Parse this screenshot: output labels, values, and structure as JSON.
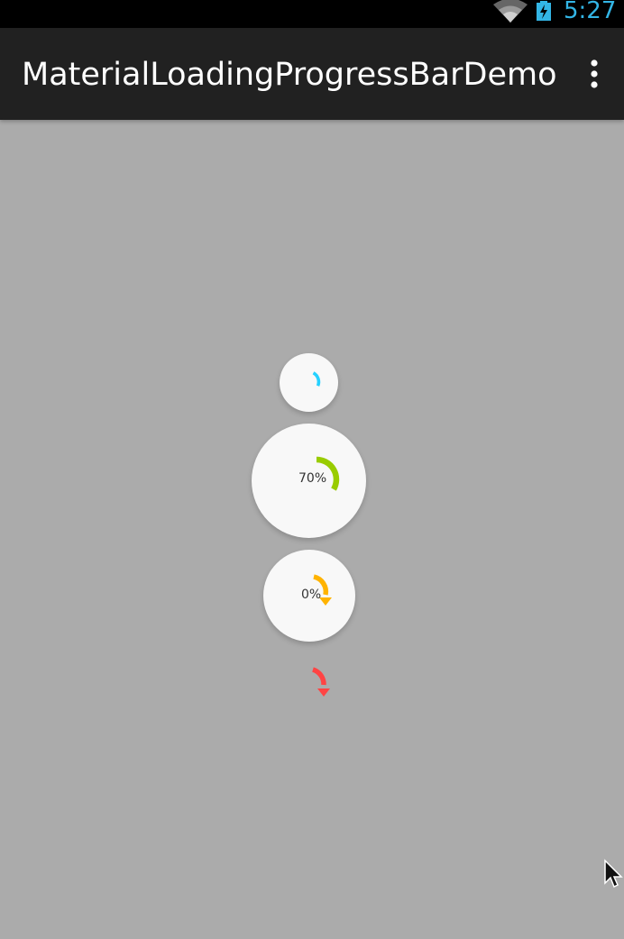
{
  "status_bar": {
    "time": "5:27",
    "icons": [
      "wifi-icon",
      "battery-charging-icon"
    ],
    "time_color": "#33b5e5"
  },
  "action_bar": {
    "title": "MaterialLoadingProgressBarDemo",
    "overflow_icon": "overflow-menu-icon"
  },
  "loaders": [
    {
      "name": "loader-small",
      "progress_label": "",
      "arc_color": "#25d1ff",
      "has_background": true,
      "arrow": false
    },
    {
      "name": "loader-large",
      "progress_label": "70%",
      "arc_color": "#99cc00",
      "has_background": true,
      "arrow": false
    },
    {
      "name": "loader-medium",
      "progress_label": "0%",
      "arc_color": "#ffb300",
      "has_background": true,
      "arrow": true
    },
    {
      "name": "loader-plain",
      "progress_label": "",
      "arc_color": "#ff4444",
      "has_background": false,
      "arrow": true
    }
  ],
  "colors": {
    "background": "#ababab",
    "action_bar": "#212121",
    "status_bar": "#000000",
    "loader_surface": "#f8f8f8"
  }
}
